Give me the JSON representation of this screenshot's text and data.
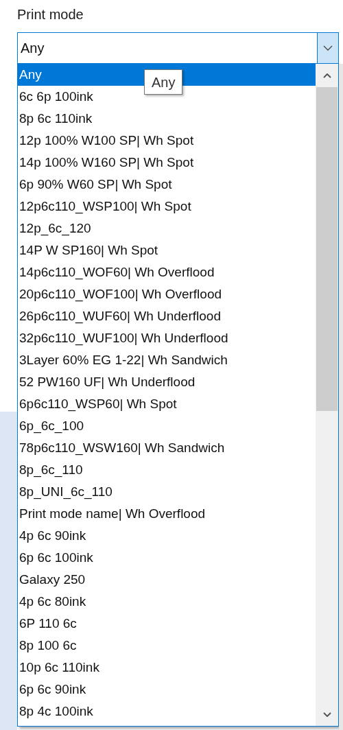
{
  "label": "Print mode",
  "combobox": {
    "value": "Any",
    "expanded": true
  },
  "tooltip": "Any",
  "items": [
    {
      "label": "Any",
      "selected": true
    },
    {
      "label": "6c 6p 100ink",
      "selected": false
    },
    {
      "label": "8p 6c 110ink",
      "selected": false
    },
    {
      "label": "12p 100% W100 SP| Wh Spot",
      "selected": false
    },
    {
      "label": "14p 100% W160 SP| Wh Spot",
      "selected": false
    },
    {
      "label": "6p 90% W60 SP| Wh Spot",
      "selected": false
    },
    {
      "label": "12p6c110_WSP100| Wh Spot",
      "selected": false
    },
    {
      "label": "12p_6c_120",
      "selected": false
    },
    {
      "label": "14P W SP160| Wh Spot",
      "selected": false
    },
    {
      "label": "14p6c110_WOF60| Wh Overflood",
      "selected": false
    },
    {
      "label": "20p6c110_WOF100| Wh Overflood",
      "selected": false
    },
    {
      "label": "26p6c110_WUF60| Wh Underflood",
      "selected": false
    },
    {
      "label": "32p6c110_WUF100| Wh Underflood",
      "selected": false
    },
    {
      "label": "3Layer 60% EG 1-22| Wh Sandwich",
      "selected": false
    },
    {
      "label": "52 PW160 UF| Wh Underflood",
      "selected": false
    },
    {
      "label": "6p6c110_WSP60| Wh Spot",
      "selected": false
    },
    {
      "label": "6p_6c_100",
      "selected": false
    },
    {
      "label": "78p6c110_WSW160| Wh Sandwich",
      "selected": false
    },
    {
      "label": "8p_6c_110",
      "selected": false
    },
    {
      "label": "8p_UNI_6c_110",
      "selected": false
    },
    {
      "label": "Print mode name| Wh Overflood",
      "selected": false
    },
    {
      "label": "4p 6c 90ink",
      "selected": false
    },
    {
      "label": "6p 6c 100ink",
      "selected": false
    },
    {
      "label": "Galaxy 250",
      "selected": false
    },
    {
      "label": "4p 6c 80ink",
      "selected": false
    },
    {
      "label": "6P 110 6c",
      "selected": false
    },
    {
      "label": "8p 100 6c",
      "selected": false
    },
    {
      "label": "10p 6c 110ink",
      "selected": false
    },
    {
      "label": "6p 6c 90ink",
      "selected": false
    },
    {
      "label": "8p 4c 100ink",
      "selected": false
    }
  ]
}
